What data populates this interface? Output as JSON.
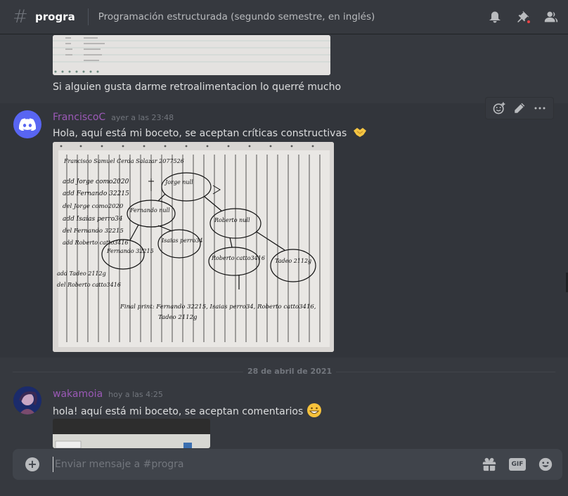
{
  "header": {
    "channel_name": "progra",
    "topic": "Programación estructurada (segundo semestre, en inglés)",
    "icons": [
      "bell-icon",
      "pin-icon",
      "members-icon"
    ]
  },
  "messages": [
    {
      "text": "Si alguien gusta darme retroalimentacion lo querré mucho"
    },
    {
      "username": "FranciscoC",
      "username_color": "#9b59b6",
      "timestamp": "ayer a las 23:48",
      "text": "Hola, aquí está mi boceto, se aceptan críticas constructivas",
      "emoji": "handshake"
    },
    {
      "username": "wakamoia",
      "username_color": "#9b59b6",
      "timestamp": "hoy a las 4:25",
      "text": "hola! aquí está mi boceto, se aceptan comentarios",
      "emoji": "grin"
    }
  ],
  "sketch": {
    "header": "Francisco Samuel Cerda Salazar   2077526",
    "ops": [
      "add Jorge como2020",
      "add Fernando 32215",
      "del Jorge como2020",
      "add Isaias perro34",
      "del Fernando 32215",
      "add Roberto catto3416",
      "add Tadeo 2112g",
      "del Roberto catto3416"
    ],
    "nodes": [
      "Jorge null",
      "Fernando null",
      "Roberto null",
      "Fernando 32215",
      "Isaias perro34",
      "Roberto catto3416",
      "Tadeo 2112g"
    ],
    "final": "Final print: Fernando 32215, Isaias perro34, Roberto catto3416,",
    "final2": "Tadeo 2112g"
  },
  "date_divider": "28 de abril de 2021",
  "composer": {
    "placeholder": "Enviar mensaje a #progra",
    "gif_label": "GIF"
  },
  "colors": {
    "background": "#36393f",
    "username": "#9b59b6",
    "discord_blurple": "#5865f2"
  }
}
